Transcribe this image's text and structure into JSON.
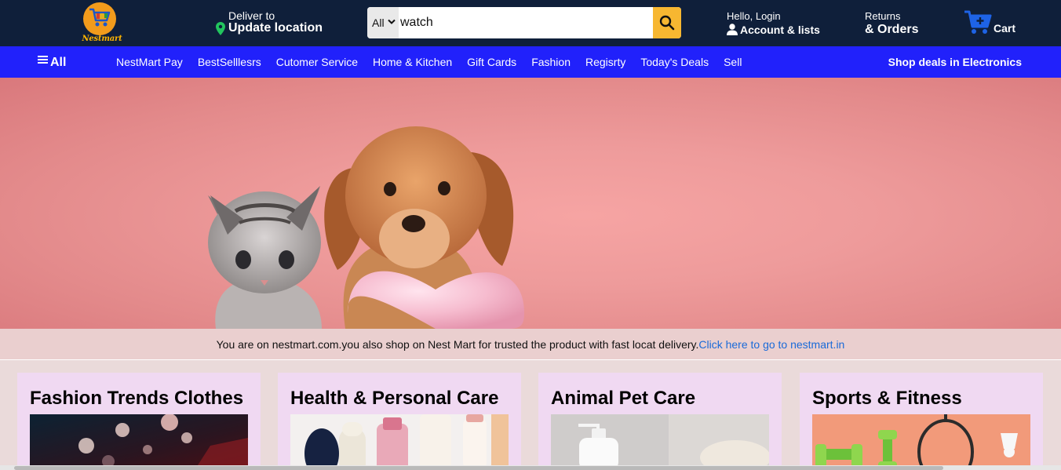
{
  "brand": {
    "logo_text": "Nestmart",
    "color_accent": "#f29b1c"
  },
  "header": {
    "deliver_small": "Deliver to",
    "deliver_big": "Update location",
    "account_small": "Hello, Login",
    "account_big": "Account & lists",
    "returns_small": "Returns",
    "returns_big": "& Orders",
    "cart_label": "Cart",
    "bg_color": "#0f1f3a"
  },
  "search": {
    "category": "All",
    "value": "watch",
    "button_icon": "search-icon",
    "button_color": "#f7b731"
  },
  "nav": {
    "all_label": "All",
    "items": [
      "NestMart Pay",
      "BestSelllesrs",
      "Cutomer Service",
      "Home & Kitchen",
      "Gift Cards",
      "Fashion",
      "Regisrty",
      "Today's Deals",
      "Sell"
    ],
    "deals_label": "Shop deals in Electronics",
    "bg_color": "#2121fb"
  },
  "notice": {
    "text": "You are on nestmart.com.you also shop on Nest Mart for trusted the product with fast locat delivery.",
    "link_text": "Click here to go to nestmart.in"
  },
  "cards": [
    {
      "title": "Fashion Trends Clothes"
    },
    {
      "title": "Health & Personal Care"
    },
    {
      "title": "Animal Pet Care"
    },
    {
      "title": "Sports & Fitness"
    }
  ]
}
